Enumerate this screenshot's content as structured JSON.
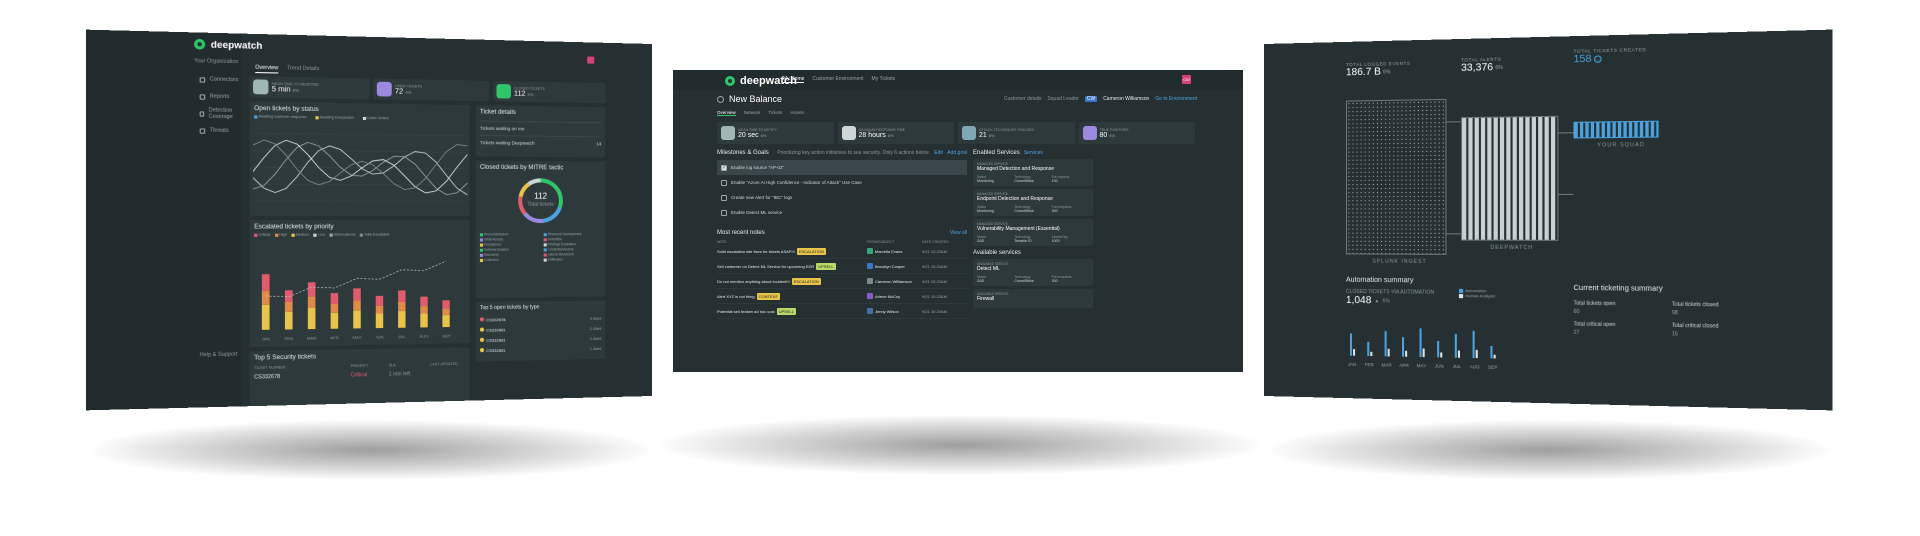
{
  "screen1": {
    "logo": "deepwatch",
    "org_label": "Your Organization",
    "tabs": [
      "Overview",
      "Trend Details"
    ],
    "nav": [
      "Connectors",
      "Reports",
      "Detection Coverage",
      "Threats"
    ],
    "help": "Help & Support",
    "kpis": [
      {
        "label": "MEAN TIME TO RESPOND",
        "value": "5 min",
        "delta": "6%"
      },
      {
        "label": "OPEN TICKETS",
        "value": "72",
        "delta": "4%"
      },
      {
        "label": "CLOSED TICKETS",
        "value": "112",
        "delta": "6%"
      }
    ],
    "open_chart_title": "Open tickets by status",
    "open_legend": [
      "Awaiting customer response",
      "Awaiting Deepwatch",
      "Under review"
    ],
    "priority_title": "Escalated tickets by priority",
    "priority_legend": [
      "Critical",
      "High",
      "Medium",
      "Low",
      "Informational",
      "Total Escalated"
    ],
    "months": [
      "JAN",
      "FEB",
      "MAR",
      "APR",
      "MAY",
      "JUN",
      "JUL",
      "AUG",
      "SEP"
    ],
    "ticket_details_title": "Ticket details",
    "ticket_details": [
      "Tickets waiting on me",
      "Tickets waiting Deepwatch"
    ],
    "ticket_details_counts": [
      "",
      "14"
    ],
    "closed_title": "Closed tickets by MITRE tactic",
    "donut_value": "112",
    "donut_label": "Total tickets",
    "mitre_legend": [
      "Reconnaissance",
      "Resource Development",
      "Initial Access",
      "Execution",
      "Persistence",
      "Privilege Escalation",
      "Defense Evasion",
      "Credential Access",
      "Discovery",
      "Lateral Movement",
      "Collection",
      "Exfiltration"
    ],
    "top_sources_title": "Top 5 open tickets by type",
    "top_sources": [
      {
        "id": "CS332678",
        "val": "5 Alert"
      },
      {
        "id": "CS332881",
        "val": "1 Alert"
      },
      {
        "id": "CS332881",
        "val": "1 Alert"
      },
      {
        "id": "CS332881",
        "val": "1 Alert"
      }
    ],
    "security_title": "Top 5 Security tickets",
    "security_cols": [
      "TICKET NUMBER",
      "PRIORITY",
      "SLA",
      "LAST UPDATED"
    ],
    "security_row": {
      "id": "CS332678",
      "priority": "Critical",
      "sla": "1 min left"
    }
  },
  "screen2": {
    "logo": "deepwatch",
    "nav": [
      "My Home",
      "Customer Environment",
      "My Tickets"
    ],
    "user_initials": "CW",
    "page_title": "New Balance",
    "header_links": [
      "Customer details",
      "Squad Leader",
      "Go to Environment"
    ],
    "squad_leader_initials": "CW",
    "squad_leader": "Cameron Williamson",
    "tabs": [
      "Overview",
      "Network",
      "Tickets",
      "Assets"
    ],
    "kpis": [
      {
        "label": "MEAN TIME TO NOTIFY",
        "value": "20 sec",
        "delta": "6%"
      },
      {
        "label": "MAXIMUM RESPONSE TIME",
        "value": "28 hours",
        "delta": "6%"
      },
      {
        "label": "ATT&CK TECHNIQUES TRACKED",
        "value": "21",
        "delta": "6%"
      },
      {
        "label": "TRUE POSITIVES",
        "value": "80",
        "delta": "6%"
      }
    ],
    "milestones_title": "Milestones & Goals",
    "milestones_hint": "Prioritizing key action initiatives to see security. Only 6 actions below.",
    "milestones_edit": "Edit",
    "milestones_add": "Add goal",
    "milestones": [
      {
        "label": "Enable log source \"AP-02\"",
        "done": true
      },
      {
        "label": "Enable \"Azure AI High Confidence - Indicator of Attack\" Use Case",
        "done": false
      },
      {
        "label": "Create new Alert for \"IBC\" logs",
        "done": false
      },
      {
        "label": "Enable Detect ML service",
        "done": false
      }
    ],
    "notes_title": "Most recent notes",
    "notes_view_all": "View all",
    "notes_cols": [
      "NOTE",
      "FROM/SUBJECT",
      "DATE CREATED"
    ],
    "notes": [
      {
        "text": "Solid escalation site fixes for tickets ASAP!!!",
        "tag": "ESCALATION",
        "tag_color": "#e8c44a",
        "av_color": "#3aa57a",
        "from": "Marvella Evans",
        "date": "9/21 10:23AM"
      },
      {
        "text": "Sell customer on Detect ML Service for upcoming EDR",
        "tag": "UPSELL",
        "tag_color": "#b9d86a",
        "av_color": "#3a77c9",
        "from": "Brooklyn Cooper",
        "date": "9/21 10:23AM"
      },
      {
        "text": "Do not mention anything about incident!!!",
        "tag": "ESCALATION",
        "tag_color": "#e8c44a",
        "av_color": "#7a8a8d",
        "from": "Cameron Williamson",
        "date": "9/21 10:23AM"
      },
      {
        "text": "Alert XYZ is not firing",
        "tag": "CONTENT",
        "tag_color": "#e8c44a",
        "av_color": "#8c5ac9",
        "from": "Arlene McCoy",
        "date": "9/21 10:23AM"
      },
      {
        "text": "Potential sell broken ad hoc cost",
        "tag": "UPSELL",
        "tag_color": "#b9d86a",
        "av_color": "#4a6ea8",
        "from": "Jenny Wilson",
        "date": "9/21 10:23AM"
      }
    ],
    "enabled_title": "Enabled Services",
    "enabled_link": "Services",
    "enabled_services": [
      {
        "kind": "MANAGED SERVICE",
        "name": "Managed Detection and Response",
        "cols": [
          "Status",
          "Technology",
          "Full capacity"
        ],
        "vals": [
          "Monitoring",
          "CrowdStrike",
          "100"
        ]
      },
      {
        "kind": "MANAGED SERVICE",
        "name": "Endpoint Detection and Response",
        "cols": [
          "Status",
          "Technology",
          "Full endpoints"
        ],
        "vals": [
          "Monitoring",
          "CrowdStrike",
          "300"
        ]
      },
      {
        "kind": "MANAGED SERVICE",
        "name": "Vulnerability Management (Essential)",
        "cols": [
          "Status",
          "Technology",
          "Assets/Day"
        ],
        "vals": [
          "SAS",
          "Tenable.IO",
          "1000"
        ]
      }
    ],
    "available_title": "Available services",
    "available_services": [
      {
        "kind": "AVAILABLE SERVICE",
        "name": "Detect ML",
        "cols": [
          "Status",
          "Technology",
          "Full endpoints"
        ],
        "vals": [
          "SAS",
          "CrowdStrike",
          "300"
        ]
      },
      {
        "kind": "AVAILABLE SERVICE",
        "name": "Firewall"
      }
    ]
  },
  "screen3": {
    "stats": [
      {
        "label": "TOTAL LOGGED EVENTS",
        "value": "186.7 B",
        "delta": "6%"
      },
      {
        "label": "TOTAL ALERTS",
        "value": "33,376",
        "delta": "6%"
      },
      {
        "label": "TOTAL TICKETS CREATED",
        "value": "158",
        "delta": ""
      }
    ],
    "stage_labels": [
      "SPLUNK INGEST",
      "DEEPWATCH",
      "YOUR SQUAD"
    ],
    "automation_title": "Automation summary",
    "automation_sub_label": "CLOSED TICKETS VIA AUTOMATION",
    "automation_value": "1,048",
    "automation_delta": "6%",
    "automation_legend": [
      "Automation",
      "Human Analysis"
    ],
    "months": [
      "JAN",
      "FEB",
      "MAR",
      "APR",
      "MAY",
      "JUN",
      "JUL",
      "AUG",
      "SEP"
    ],
    "automation_bars": [
      0.55,
      0.35,
      0.62,
      0.48,
      0.7,
      0.4,
      0.58,
      0.66,
      0.3
    ],
    "ticketing_title": "Current ticketing summary",
    "ticketing": [
      {
        "label": "Total tickets open",
        "value": "60"
      },
      {
        "label": "Total tickets closed",
        "value": "98"
      },
      {
        "label": "Total critical open",
        "value": "27"
      },
      {
        "label": "Total critical closed",
        "value": "15"
      }
    ]
  }
}
